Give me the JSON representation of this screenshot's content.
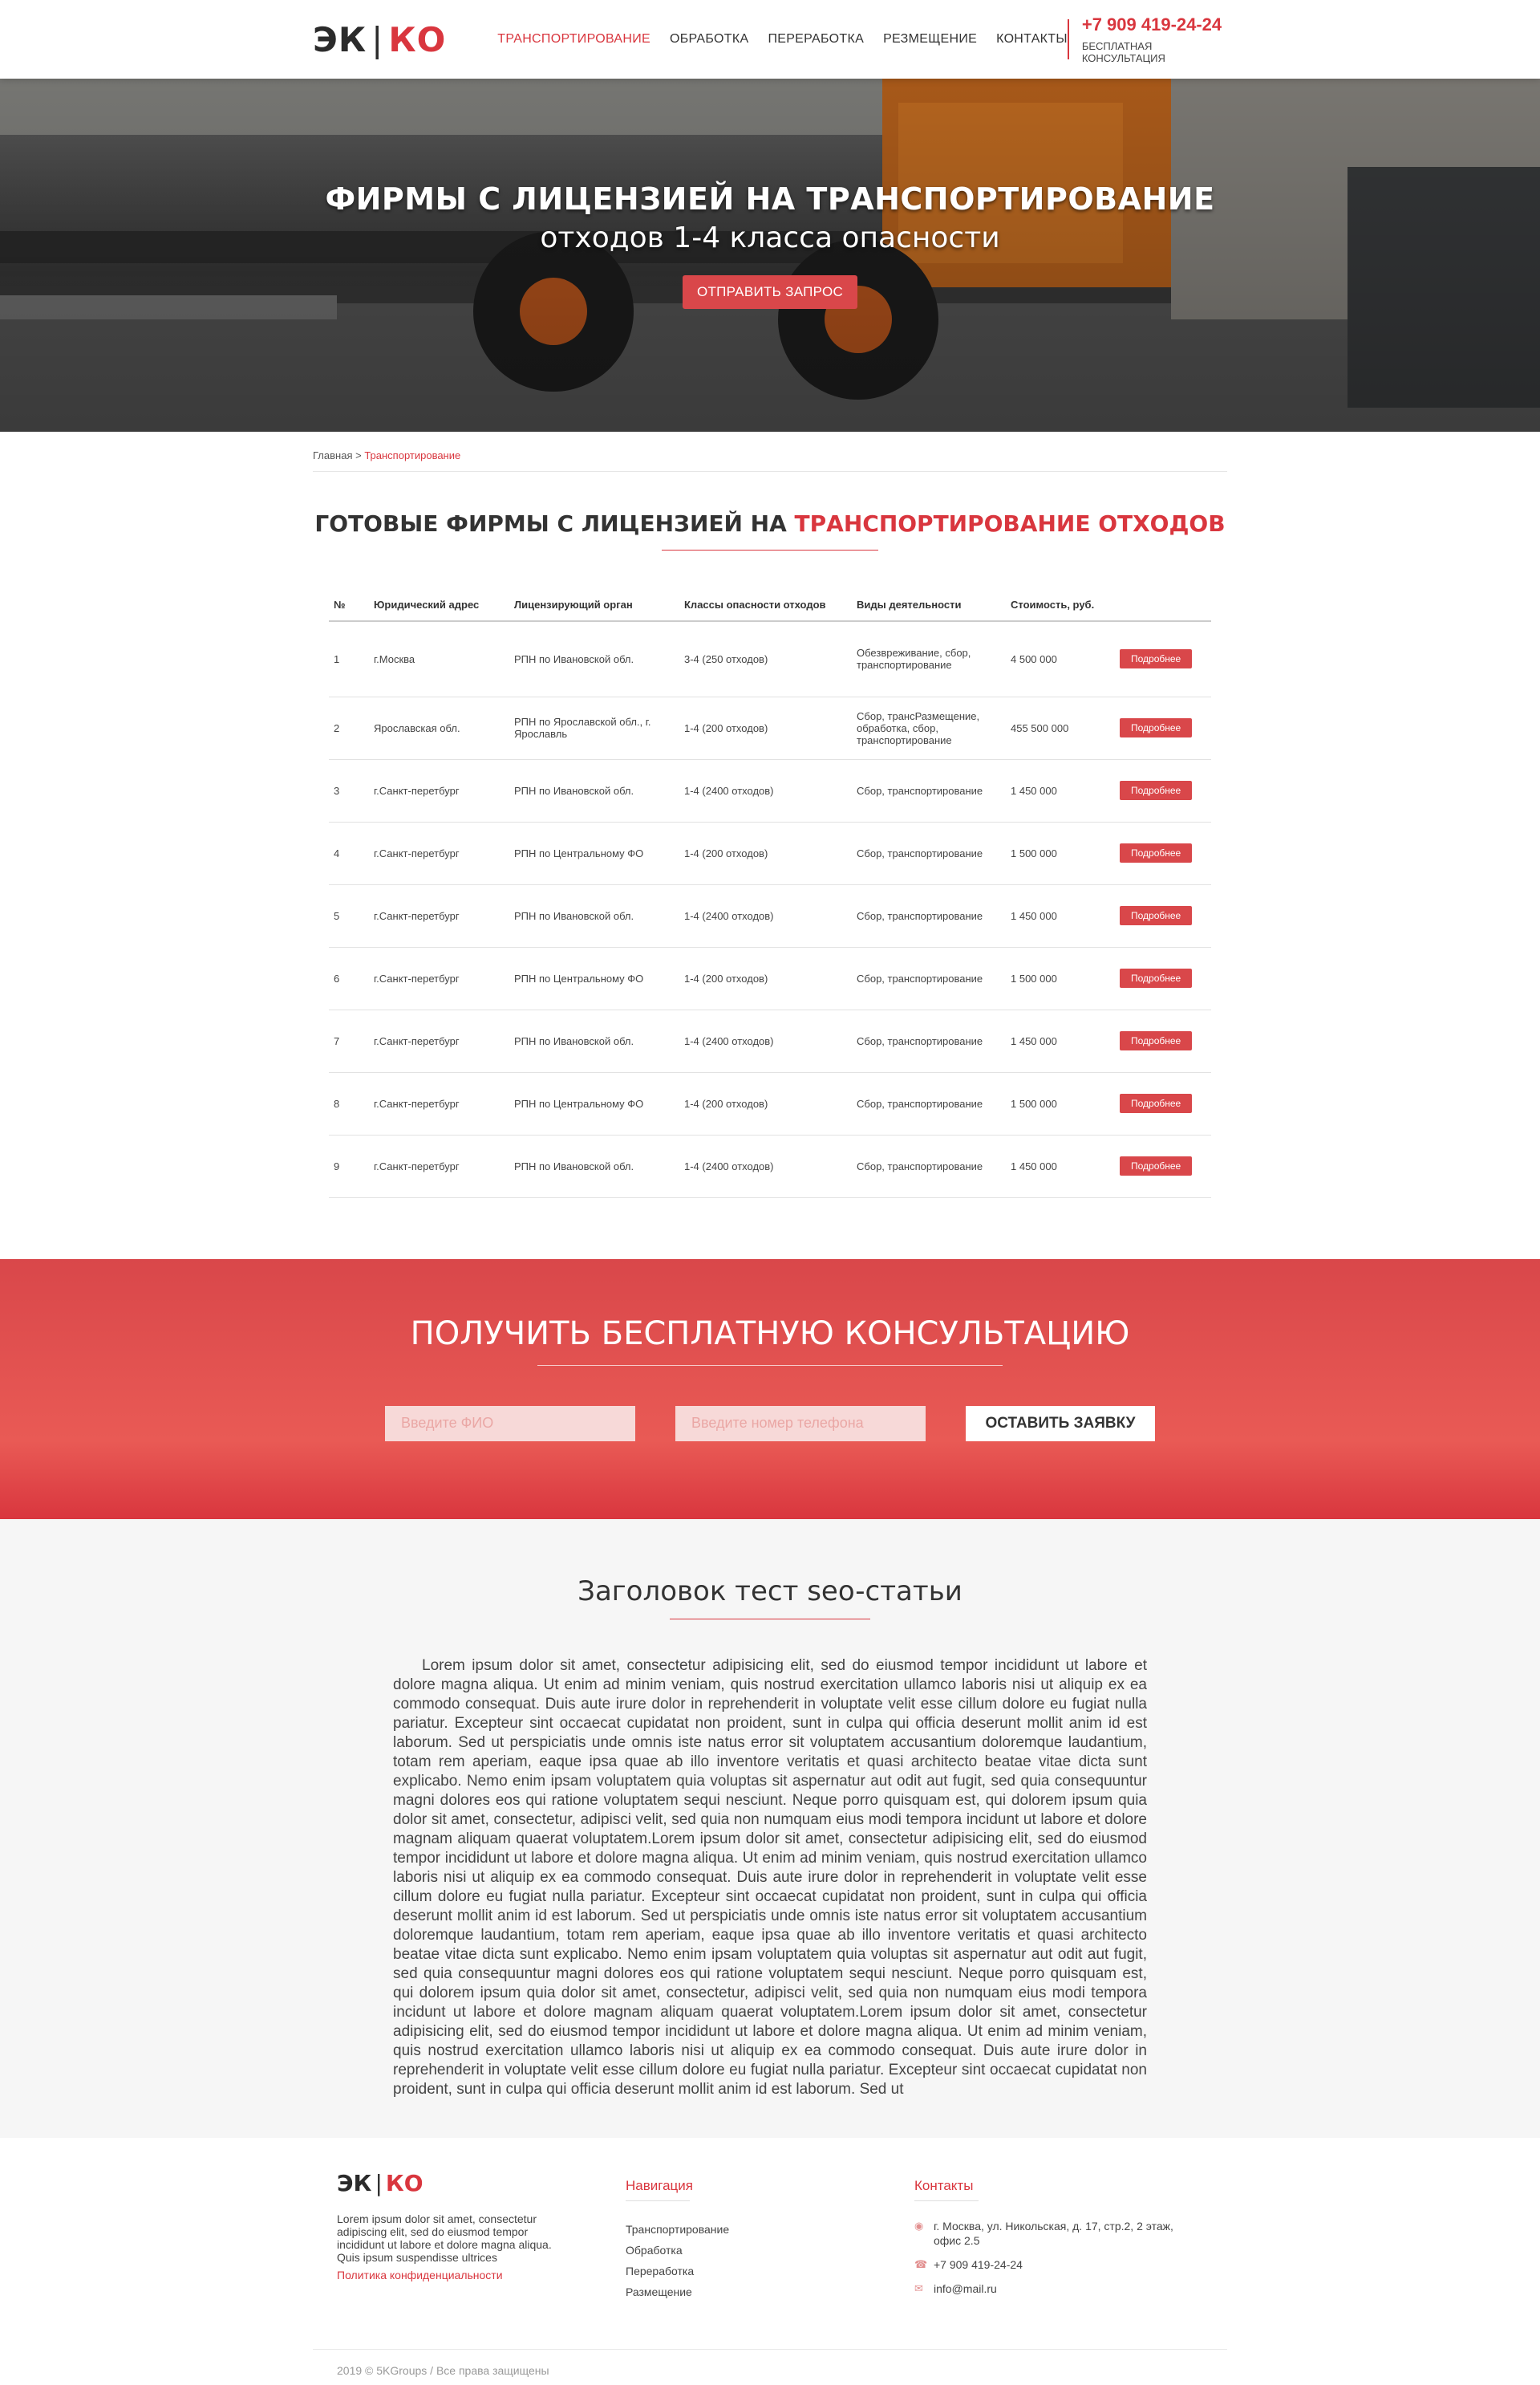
{
  "header": {
    "logo_left": "ЭК",
    "logo_sep": "|",
    "logo_right": "КО",
    "nav": [
      "Транспортирование",
      "Обработка",
      "Переработка",
      "Резмещение",
      "Контакты"
    ],
    "phone": "+7 909 419-24-24",
    "phone_sub": "Бесплатная консультация"
  },
  "hero": {
    "title": "Фирмы с лицензией на транспортирование",
    "subtitle": "отходов 1-4 класса опасности",
    "button": "Отправить запрос"
  },
  "breadcrumb": {
    "home": "Главная",
    "sep": ">",
    "current": "Транспортирование"
  },
  "section": {
    "title_plain": "Готовые фирмы с лицензией на",
    "title_red": "транспортирование отходов"
  },
  "table": {
    "headers": [
      "№",
      "Юридический адрес",
      "Лицензирующий орган",
      "Классы опасности отходов",
      "Виды деятельности",
      "Стоимость, руб."
    ],
    "button": "Подробнее",
    "rows": [
      [
        "1",
        "г.Москва",
        "РПН по Ивановской обл.",
        "3-4 (250 отходов)",
        "Обезвреживание, сбор, транспортирование",
        "4 500 000"
      ],
      [
        "2",
        "Ярославская обл.",
        "РПН по Ярославской обл., г. Ярославль",
        "1-4 (200 отходов)",
        "Сбор, трансРазмещение, обработка, сбор, транспортирование",
        "455 500 000"
      ],
      [
        "3",
        "г.Санкт-перетбург",
        "РПН по Ивановской обл.",
        "1-4 (2400 отходов)",
        "Сбор, транспортирование",
        "1 450 000"
      ],
      [
        "4",
        "г.Санкт-перетбург",
        "РПН по Центральному ФО",
        "1-4 (200 отходов)",
        "Сбор, транспортирование",
        "1 500 000"
      ],
      [
        "5",
        "г.Санкт-перетбург",
        "РПН по Ивановской обл.",
        "1-4 (2400 отходов)",
        "Сбор, транспортирование",
        "1 450 000"
      ],
      [
        "6",
        "г.Санкт-перетбург",
        "РПН по Центральному ФО",
        "1-4 (200 отходов)",
        "Сбор, транспортирование",
        "1 500 000"
      ],
      [
        "7",
        "г.Санкт-перетбург",
        "РПН по Ивановской обл.",
        "1-4 (2400 отходов)",
        "Сбор, транспортирование",
        "1 450 000"
      ],
      [
        "8",
        "г.Санкт-перетбург",
        "РПН по Центральному ФО",
        "1-4 (200 отходов)",
        "Сбор, транспортирование",
        "1 500 000"
      ],
      [
        "9",
        "г.Санкт-перетбург",
        "РПН по Ивановской обл.",
        "1-4 (2400 отходов)",
        "Сбор, транспортирование",
        "1 450 000"
      ]
    ]
  },
  "consult": {
    "title": "Получить бесплатную консультацию",
    "name_placeholder": "Введите ФИО",
    "phone_placeholder": "Введите номер телефона",
    "button": "Оставить заявку"
  },
  "seo": {
    "title": "Заголовок тест seo-статьи",
    "text": "Lorem ipsum dolor sit amet, consectetur adipisicing elit, sed do eiusmod tempor incididunt ut labore et dolore magna aliqua. Ut enim ad minim veniam, quis nostrud exercitation ullamco laboris nisi ut aliquip ex ea commodo consequat. Duis aute irure dolor in reprehenderit in voluptate velit esse cillum dolore eu fugiat nulla pariatur. Excepteur sint occaecat cupidatat non proident, sunt in culpa qui officia deserunt mollit anim id est laborum. Sed ut perspiciatis unde omnis iste natus error sit voluptatem accusantium doloremque laudantium, totam rem aperiam, eaque ipsa quae ab illo inventore veritatis et quasi architecto beatae vitae dicta sunt explicabo. Nemo enim ipsam voluptatem quia voluptas sit aspernatur aut odit aut fugit, sed quia consequuntur magni dolores eos qui ratione voluptatem sequi nesciunt. Neque porro quisquam est, qui dolorem ipsum quia dolor sit amet, consectetur, adipisci velit, sed quia non numquam eius modi tempora incidunt ut labore et dolore magnam aliquam quaerat voluptatem.Lorem ipsum dolor sit amet, consectetur adipisicing elit, sed do eiusmod tempor incididunt ut labore et dolore magna aliqua. Ut enim ad minim veniam, quis nostrud exercitation ullamco laboris nisi ut aliquip ex ea commodo consequat. Duis aute irure dolor in reprehenderit in voluptate velit esse cillum dolore eu fugiat nulla pariatur. Excepteur sint occaecat cupidatat non proident, sunt in culpa qui officia deserunt mollit anim id est laborum. Sed ut perspiciatis unde omnis iste natus error sit voluptatem accusantium doloremque laudantium, totam rem aperiam, eaque ipsa quae ab illo inventore veritatis et quasi architecto beatae vitae dicta sunt explicabo. Nemo enim ipsam voluptatem quia voluptas sit aspernatur aut odit aut fugit, sed quia consequuntur magni dolores eos qui ratione voluptatem sequi nesciunt. Neque porro quisquam est, qui dolorem ipsum quia dolor sit amet, consectetur, adipisci velit, sed quia non numquam eius modi tempora incidunt ut labore et dolore magnam aliquam quaerat voluptatem.Lorem ipsum dolor sit amet, consectetur adipisicing elit, sed do eiusmod tempor incididunt ut labore et dolore magna aliqua. Ut enim ad minim veniam, quis nostrud exercitation ullamco laboris nisi ut aliquip ex ea commodo consequat. Duis aute irure dolor in reprehenderit in voluptate velit esse cillum dolore eu fugiat nulla pariatur. Excepteur sint occaecat cupidatat non proident, sunt in culpa qui officia deserunt mollit anim id est laborum. Sed ut"
  },
  "footer": {
    "about": "Lorem ipsum dolor sit amet, consectetur adipiscing elit, sed do eiusmod tempor incididunt ut labore et dolore magna aliqua. Quis ipsum suspendisse ultrices",
    "policy": "Политика конфиденциальности",
    "nav_title": "Навигация",
    "nav": [
      "Транспортирование",
      "Обработка",
      "Переработка",
      "Размещение"
    ],
    "contacts_title": "Контакты",
    "address": "г. Москва, ул. Никольская, д. 17, стр.2, 2 этаж, офис 2.5",
    "phone": "+7 909 419-24-24",
    "email": "info@mail.ru",
    "copyright": "2019 © 5KGroups / Все права защищены"
  },
  "colors": {
    "accent": "#d9363e",
    "button": "#d9474a",
    "banner": "#e05450"
  },
  "icons": [
    "location-icon",
    "phone-icon",
    "mail-icon"
  ]
}
